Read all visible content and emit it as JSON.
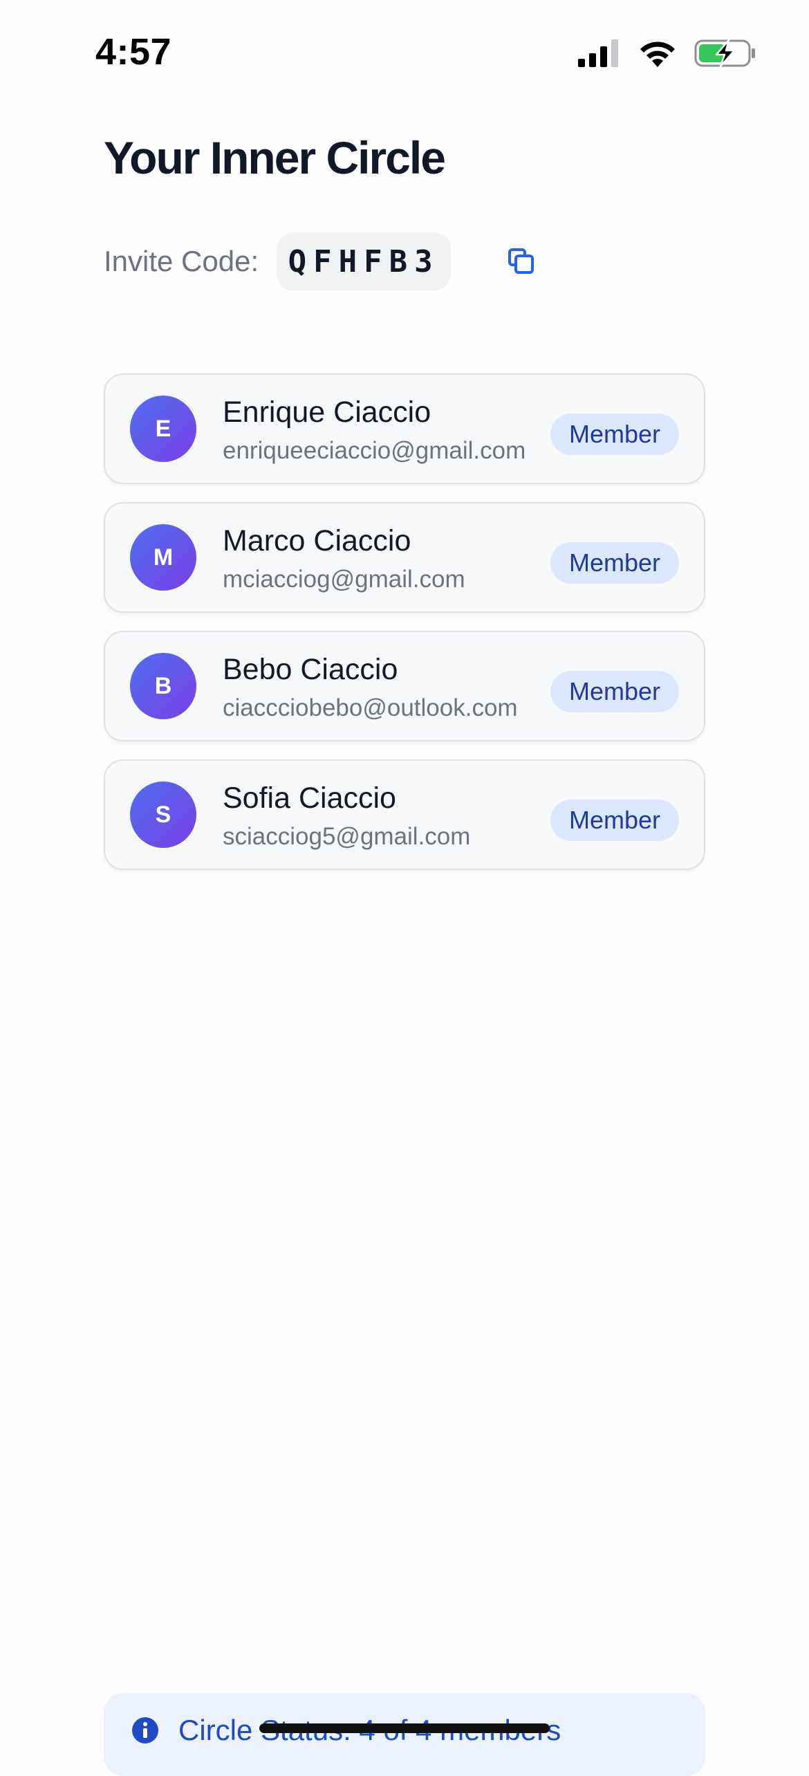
{
  "status_bar": {
    "time": "4:57",
    "icons": [
      "signal-icon",
      "wifi-icon",
      "battery-charging-icon"
    ]
  },
  "page": {
    "title": "Your Inner Circle"
  },
  "invite": {
    "label": "Invite Code:",
    "code": "QFHFB3",
    "copy_icon": "copy-icon"
  },
  "members": [
    {
      "initial": "E",
      "name": "Enrique Ciaccio",
      "email": "enriqueeciaccio@gmail.com",
      "role": "Member"
    },
    {
      "initial": "M",
      "name": "Marco Ciaccio",
      "email": "mciacciog@gmail.com",
      "role": "Member"
    },
    {
      "initial": "B",
      "name": "Bebo Ciaccio",
      "email": "ciaccciobebo@outlook.com",
      "role": "Member"
    },
    {
      "initial": "S",
      "name": "Sofia Ciaccio",
      "email": "sciacciog5@gmail.com",
      "role": "Member"
    }
  ],
  "circle_status": {
    "icon": "info-icon",
    "text": "Circle Status: 4 of 4 members"
  },
  "colors": {
    "accent": "#2563eb",
    "badge_bg": "#dce7fb",
    "badge_text": "#1e3a9c",
    "avatar_gradient_start": "#4f6ff0",
    "avatar_gradient_end": "#7b3fe4",
    "battery_charging": "#34c759"
  }
}
